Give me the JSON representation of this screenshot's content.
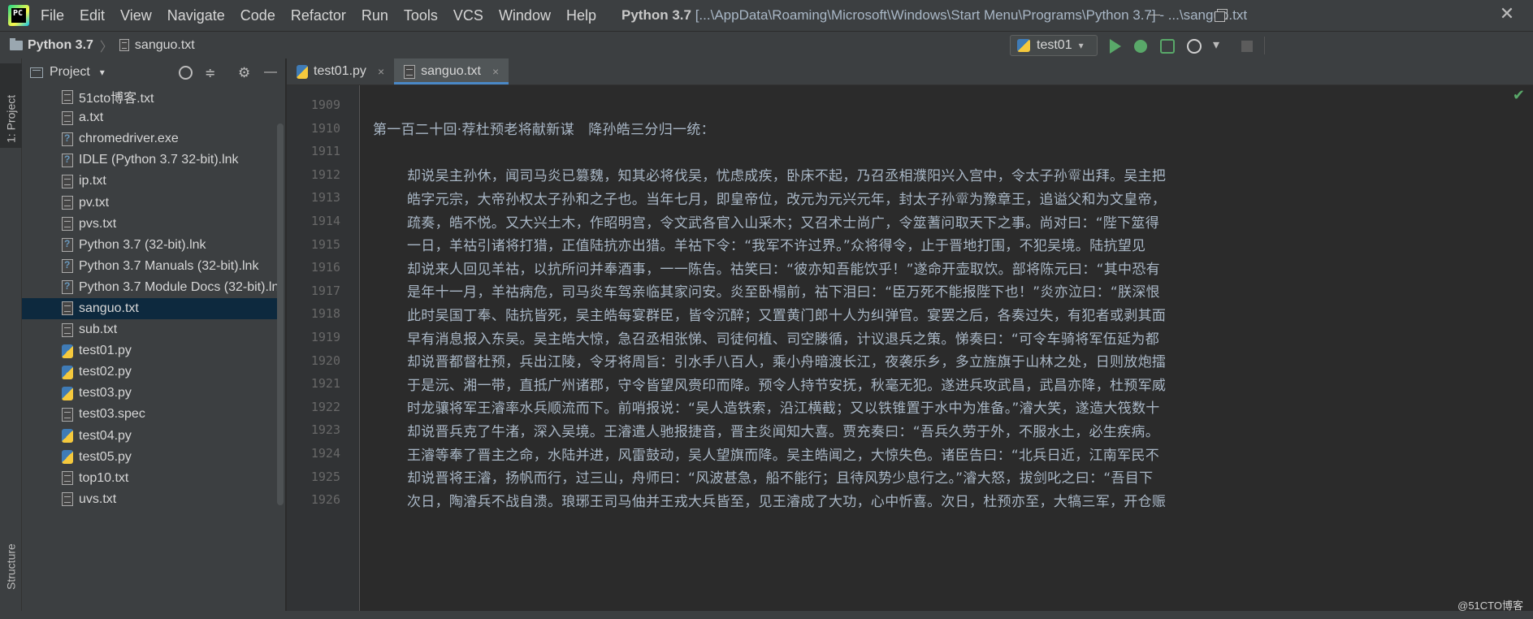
{
  "menubar": {
    "logo_text": "PC",
    "items": [
      "File",
      "Edit",
      "View",
      "Navigate",
      "Code",
      "Refactor",
      "Run",
      "Tools",
      "VCS",
      "Window",
      "Help"
    ],
    "window_title_project": "Python 3.7",
    "window_title_rest": "[...\\AppData\\Roaming\\Microsoft\\Windows\\Start Menu\\Programs\\Python 3.7] - ...\\sanguo.txt",
    "close_glyph": "✕"
  },
  "navbar": {
    "project": "Python 3.7",
    "separator": "〉",
    "file": "sanguo.txt",
    "run_config": "test01",
    "chevron": "▾"
  },
  "left_strip": {
    "project_tab": "1: Project",
    "structure_tab": "Structure"
  },
  "project_panel": {
    "title": "Project",
    "chevron": "▾",
    "collapse_glyph": "≑",
    "gear_glyph": "⚙",
    "hide_glyph": "—",
    "files": [
      {
        "name": "51cto博客.txt",
        "icon": "text-file-icon"
      },
      {
        "name": "a.txt",
        "icon": "text-file-icon"
      },
      {
        "name": "chromedriver.exe",
        "icon": "unknown-file-icon"
      },
      {
        "name": "IDLE (Python 3.7 32-bit).lnk",
        "icon": "unknown-file-icon"
      },
      {
        "name": "ip.txt",
        "icon": "text-file-icon"
      },
      {
        "name": "pv.txt",
        "icon": "text-file-icon"
      },
      {
        "name": "pvs.txt",
        "icon": "text-file-icon"
      },
      {
        "name": "Python 3.7 (32-bit).lnk",
        "icon": "unknown-file-icon"
      },
      {
        "name": "Python 3.7 Manuals (32-bit).lnk",
        "icon": "unknown-file-icon"
      },
      {
        "name": "Python 3.7 Module Docs (32-bit).lnk",
        "icon": "unknown-file-icon"
      },
      {
        "name": "sanguo.txt",
        "icon": "text-file-icon",
        "selected": true
      },
      {
        "name": "sub.txt",
        "icon": "text-file-icon"
      },
      {
        "name": "test01.py",
        "icon": "python-file-icon"
      },
      {
        "name": "test02.py",
        "icon": "python-file-icon"
      },
      {
        "name": "test03.py",
        "icon": "python-file-icon"
      },
      {
        "name": "test03.spec",
        "icon": "text-file-icon"
      },
      {
        "name": "test04.py",
        "icon": "python-file-icon"
      },
      {
        "name": "test05.py",
        "icon": "python-file-icon"
      },
      {
        "name": "top10.txt",
        "icon": "text-file-icon"
      },
      {
        "name": "uvs.txt",
        "icon": "text-file-icon"
      }
    ]
  },
  "editor_tabs": [
    {
      "label": "test01.py",
      "icon": "python-file-icon",
      "close": "×",
      "active": false
    },
    {
      "label": "sanguo.txt",
      "icon": "text-file-icon",
      "close": "×",
      "active": true
    }
  ],
  "editor": {
    "lines": [
      {
        "num": "1909",
        "text": "",
        "indent": false
      },
      {
        "num": "1910",
        "text": "第一百二十回·荐杜预老将献新谋　降孙皓三分归一统：",
        "indent": false
      },
      {
        "num": "1911",
        "text": "",
        "indent": false
      },
      {
        "num": "1912",
        "text": "却说吴主孙休，闻司马炎已篡魏，知其必将伐吴，忧虑成疾，卧床不起，乃召丞相濮阳兴入宫中，令太子孙𩅦出拜。吴主把",
        "indent": true
      },
      {
        "num": "1913",
        "text": "皓字元宗，大帝孙权太子孙和之子也。当年七月，即皇帝位，改元为元兴元年，封太子孙𩅦为豫章王，追谥父和为文皇帝，",
        "indent": true
      },
      {
        "num": "1914",
        "text": "疏奏，皓不悦。又大兴土木，作昭明宫，令文武各官入山采木；又召术士尚广，令筮蓍问取天下之事。尚对曰：“陛下筮得",
        "indent": true
      },
      {
        "num": "1915",
        "text": "一日，羊祜引诸将打猎，正值陆抗亦出猎。羊祜下令：“我军不许过界。”众将得令，止于晋地打围，不犯吴境。陆抗望见",
        "indent": true
      },
      {
        "num": "1916",
        "text": "却说来人回见羊祜，以抗所问并奉酒事，一一陈告。祜笑曰：“彼亦知吾能饮乎！”遂命开壶取饮。部将陈元曰：“其中恐有",
        "indent": true
      },
      {
        "num": "1917",
        "text": "是年十一月，羊祜病危，司马炎车驾亲临其家问安。炎至卧榻前，祜下泪曰：“臣万死不能报陛下也！”炎亦泣曰：“朕深恨",
        "indent": true
      },
      {
        "num": "1918",
        "text": "此时吴国丁奉、陆抗皆死，吴主皓每宴群臣，皆令沉醉；又置黄门郎十人为纠弹官。宴罢之后，各奏过失，有犯者或剥其面",
        "indent": true
      },
      {
        "num": "1919",
        "text": "早有消息报入东吴。吴主皓大惊，急召丞相张悌、司徒何植、司空滕循，计议退兵之策。悌奏曰：“可令车骑将军伍延为都",
        "indent": true
      },
      {
        "num": "1920",
        "text": "却说晋都督杜预，兵出江陵，令牙将周旨：引水手八百人，乘小舟暗渡长江，夜袭乐乡，多立旌旗于山林之处，日则放炮擂",
        "indent": true
      },
      {
        "num": "1921",
        "text": "于是沅、湘一带，直抵广州诸郡，守令皆望风赍印而降。预令人持节安抚，秋毫无犯。遂进兵攻武昌，武昌亦降，杜预军威",
        "indent": true
      },
      {
        "num": "1922",
        "text": "时龙骧将军王濬率水兵顺流而下。前哨报说：“吴人造铁索，沿江横截；又以铁锥置于水中为准备。”濬大笑，遂造大筏数十",
        "indent": true
      },
      {
        "num": "1923",
        "text": "却说晋兵克了牛渚，深入吴境。王濬遣人驰报捷音，晋主炎闻知大喜。贾充奏曰：“吾兵久劳于外，不服水土，必生疾病。",
        "indent": true
      },
      {
        "num": "1924",
        "text": "王濬等奉了晋主之命，水陆并进，风雷鼓动，吴人望旗而降。吴主皓闻之，大惊失色。诸臣告曰：“北兵日近，江南军民不",
        "indent": true
      },
      {
        "num": "1925",
        "text": "却说晋将王濬，扬帆而行，过三山，舟师曰：“风波甚急，船不能行；且待风势少息行之。”濬大怒，拔剑叱之曰：“吾目下",
        "indent": true
      },
      {
        "num": "1926",
        "text": "次日，陶濬兵不战自溃。琅琊王司马伷并王戎大兵皆至，见王濬成了大功，心中忻喜。次日，杜预亦至，大犒三军，开仓赈",
        "indent": true
      }
    ],
    "check_glyph": "✔"
  },
  "watermark": "@51CTO博客"
}
